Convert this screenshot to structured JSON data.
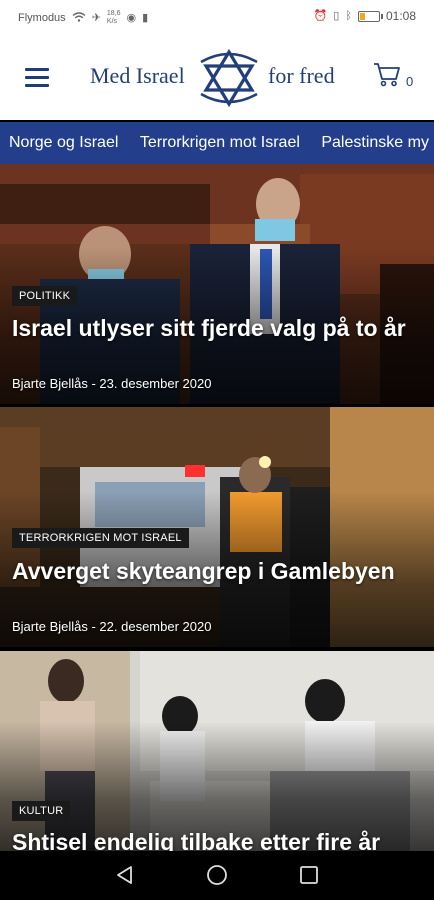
{
  "status_bar": {
    "carrier": "Flymodus",
    "net_speed_top": "18,6",
    "net_speed_bottom": "K/s",
    "time": "01:08",
    "battery_level": 0.3,
    "icons": [
      "wifi-icon",
      "airplane-icon",
      "battery-icon",
      "alarm-icon",
      "vibrate-icon",
      "bluetooth-icon"
    ]
  },
  "header": {
    "brand_left": "Med Israel",
    "brand_right": "for fred",
    "cart_count": "0",
    "brand_color": "#233f7a",
    "icons": [
      "menu-icon",
      "star-of-david-logo",
      "cart-icon"
    ]
  },
  "nav": {
    "items": [
      "Norge og Israel",
      "Terrorkrigen mot Israel",
      "Palestinske my"
    ],
    "bg_color": "#233f8c"
  },
  "articles": [
    {
      "category": "POLITIKK",
      "title": "Israel utlyser sitt fjerde valg på to år",
      "byline": "Bjarte Bjellås - 23. desember 2020"
    },
    {
      "category": "TERRORKRIGEN MOT ISRAEL",
      "title": "Avverget skyteangrep i Gamlebyen",
      "byline": "Bjarte Bjellås - 22. desember 2020"
    },
    {
      "category": "KULTUR",
      "title": "Shtisel endelig tilbake etter fire år",
      "byline": ""
    }
  ],
  "system_nav": {
    "icons": [
      "back-icon",
      "home-icon",
      "recents-icon"
    ]
  }
}
